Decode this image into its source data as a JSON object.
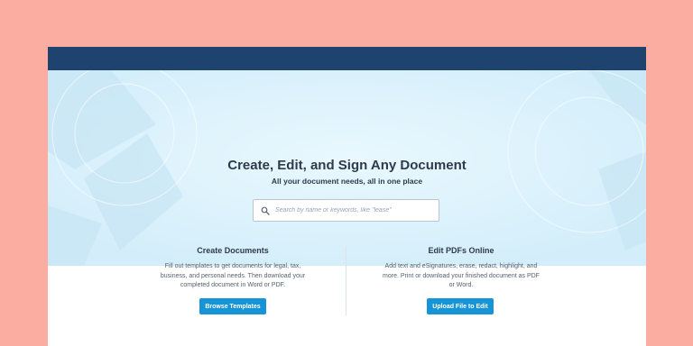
{
  "hero": {
    "title": "Create, Edit, and Sign Any Document",
    "subtitle": "All your document needs, all in one place"
  },
  "search": {
    "placeholder": "Search by name or keywords, like \"lease\"",
    "icon": "search-icon"
  },
  "features": [
    {
      "title": "Create Documents",
      "description": "Fill out templates to get documents for legal, tax, business, and personal needs. Then download your completed document in Word or PDF.",
      "button_label": "Browse Templates"
    },
    {
      "title": "Edit PDFs Online",
      "description": "Add text and eSignatures, erase, redact, highlight, and more. Print or download your finished document as PDF or Word.",
      "button_label": "Upload File to Edit"
    }
  ],
  "colors": {
    "page_background": "#fbada1",
    "topbar": "#1e436e",
    "hero_background": "#daf2fc",
    "button": "#1694d6",
    "heading_text": "#2f3a4b"
  }
}
